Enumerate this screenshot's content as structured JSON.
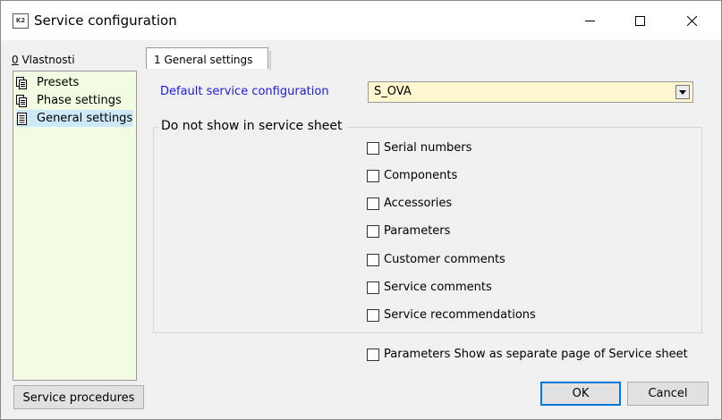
{
  "window": {
    "title": "Service configuration",
    "icon_text": "K2"
  },
  "left_panel": {
    "tab_accel": "0",
    "tab_rest": " Vlastnosti",
    "items": [
      {
        "label": "Presets"
      },
      {
        "label": "Phase settings"
      },
      {
        "label": "General settings",
        "selected": true
      }
    ],
    "procedures_button": "Service procedures"
  },
  "main": {
    "tab_label": "1 General settings",
    "default_config_label": "Default service configuration",
    "default_config_value": "S_OVA",
    "group_title": "Do not show in service sheet",
    "checkboxes": [
      {
        "label": "Serial numbers",
        "checked": false
      },
      {
        "label": "Components",
        "checked": false
      },
      {
        "label": "Accessories",
        "checked": false
      },
      {
        "label": "Parameters",
        "checked": false
      },
      {
        "label": "Customer comments",
        "checked": false
      },
      {
        "label": "Service comments",
        "checked": false
      },
      {
        "label": "Service recommendations",
        "checked": false
      }
    ],
    "separate_page": {
      "label": "Parameters Show as separate page of Service sheet",
      "checked": false
    }
  },
  "footer": {
    "ok_label": "OK",
    "cancel_label": "Cancel"
  },
  "colors": {
    "tree_background": "#f1fce3",
    "selection": "#cde8f6",
    "combo_background": "#fff7cf",
    "label_blue": "#1c1cdb",
    "default_button_border": "#0078d7"
  }
}
